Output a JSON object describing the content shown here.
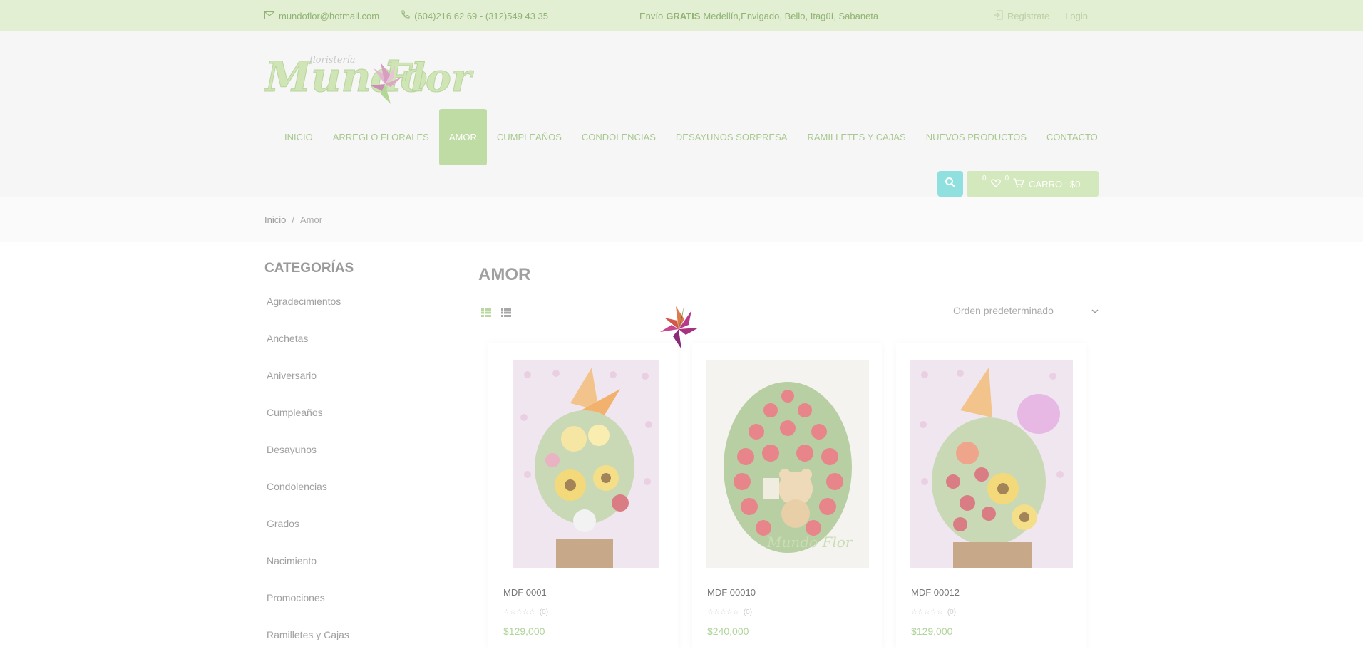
{
  "topbar": {
    "email": "mundoflor@hotmail.com",
    "phone": "(604)216 62 69 - (312)549 43 35",
    "promo_pre": "Envío",
    "promo_bold": "GRATIS",
    "promo_post": "Medellín,Envigado, Bello, Itagüí, Sabaneta",
    "register": "Registrate",
    "login": "Login"
  },
  "logo": {
    "text": "Mundo Flor",
    "subtitle": "floristería"
  },
  "nav": [
    {
      "label": "INICIO"
    },
    {
      "label": "ARREGLO FLORALES"
    },
    {
      "label": "AMOR"
    },
    {
      "label": "CUMPLEAÑOS"
    },
    {
      "label": "CONDOLENCIAS"
    },
    {
      "label": "DESAYUNOS SORPRESA"
    },
    {
      "label": "RAMILLETES Y CAJAS"
    },
    {
      "label": "NUEVOS PRODUCTOS"
    },
    {
      "label": "CONTACTO"
    }
  ],
  "cart": {
    "wishlist_count": "0",
    "cart_count": "0",
    "label": "CARRO : $0"
  },
  "breadcrumb": {
    "home": "Inicio",
    "separator": "/",
    "current": "Amor"
  },
  "sidebar": {
    "title": "CATEGORÍAS",
    "items": [
      {
        "label": "Agradecimientos"
      },
      {
        "label": "Anchetas"
      },
      {
        "label": "Aniversario"
      },
      {
        "label": "Cumpleaños"
      },
      {
        "label": "Desayunos"
      },
      {
        "label": "Condolencias"
      },
      {
        "label": "Grados"
      },
      {
        "label": "Nacimiento"
      },
      {
        "label": "Promociones"
      },
      {
        "label": "Ramilletes y Cajas"
      }
    ]
  },
  "main": {
    "title": "AMOR",
    "sort_selected": "Orden predeterminado"
  },
  "products": [
    {
      "name": "MDF 0001",
      "reviews": "(0)",
      "price": "$129,000"
    },
    {
      "name": "MDF 00010",
      "reviews": "(0)",
      "price": "$240,000"
    },
    {
      "name": "MDF 00012",
      "reviews": "(0)",
      "price": "$129,000"
    }
  ],
  "colors": {
    "topbar_bg": "#e2efd2",
    "accent_green": "#bfdca4",
    "search_button": "#8fe0df",
    "price": "#b0d49a"
  }
}
